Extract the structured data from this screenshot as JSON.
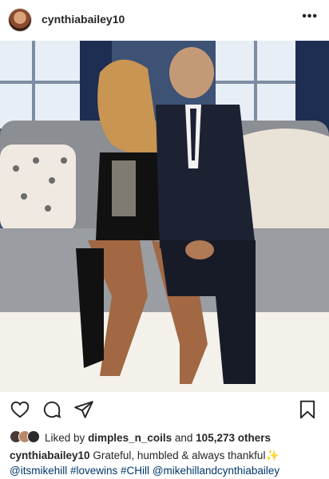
{
  "post": {
    "username": "cynthiabailey10",
    "more_icon": "more-horizontal-icon"
  },
  "photo": {
    "description_icon": "post-photo"
  },
  "actions": {
    "like_icon": "heart-icon",
    "comment_icon": "comment-icon",
    "share_icon": "send-icon",
    "save_icon": "bookmark-icon"
  },
  "likes": {
    "prefix": "Liked by",
    "user": "dimples_n_coils",
    "and": "and",
    "count": "105,273 others"
  },
  "caption": {
    "username": "cynthiabailey10",
    "text": "Grateful, humbled & always thankful",
    "emoji": "✨",
    "tags": [
      "@itsmikehill",
      "#lovewins",
      "#CHill",
      "@mikehillandcynthiabailey"
    ]
  },
  "colors": {
    "link": "#00376b",
    "text": "#262626"
  }
}
